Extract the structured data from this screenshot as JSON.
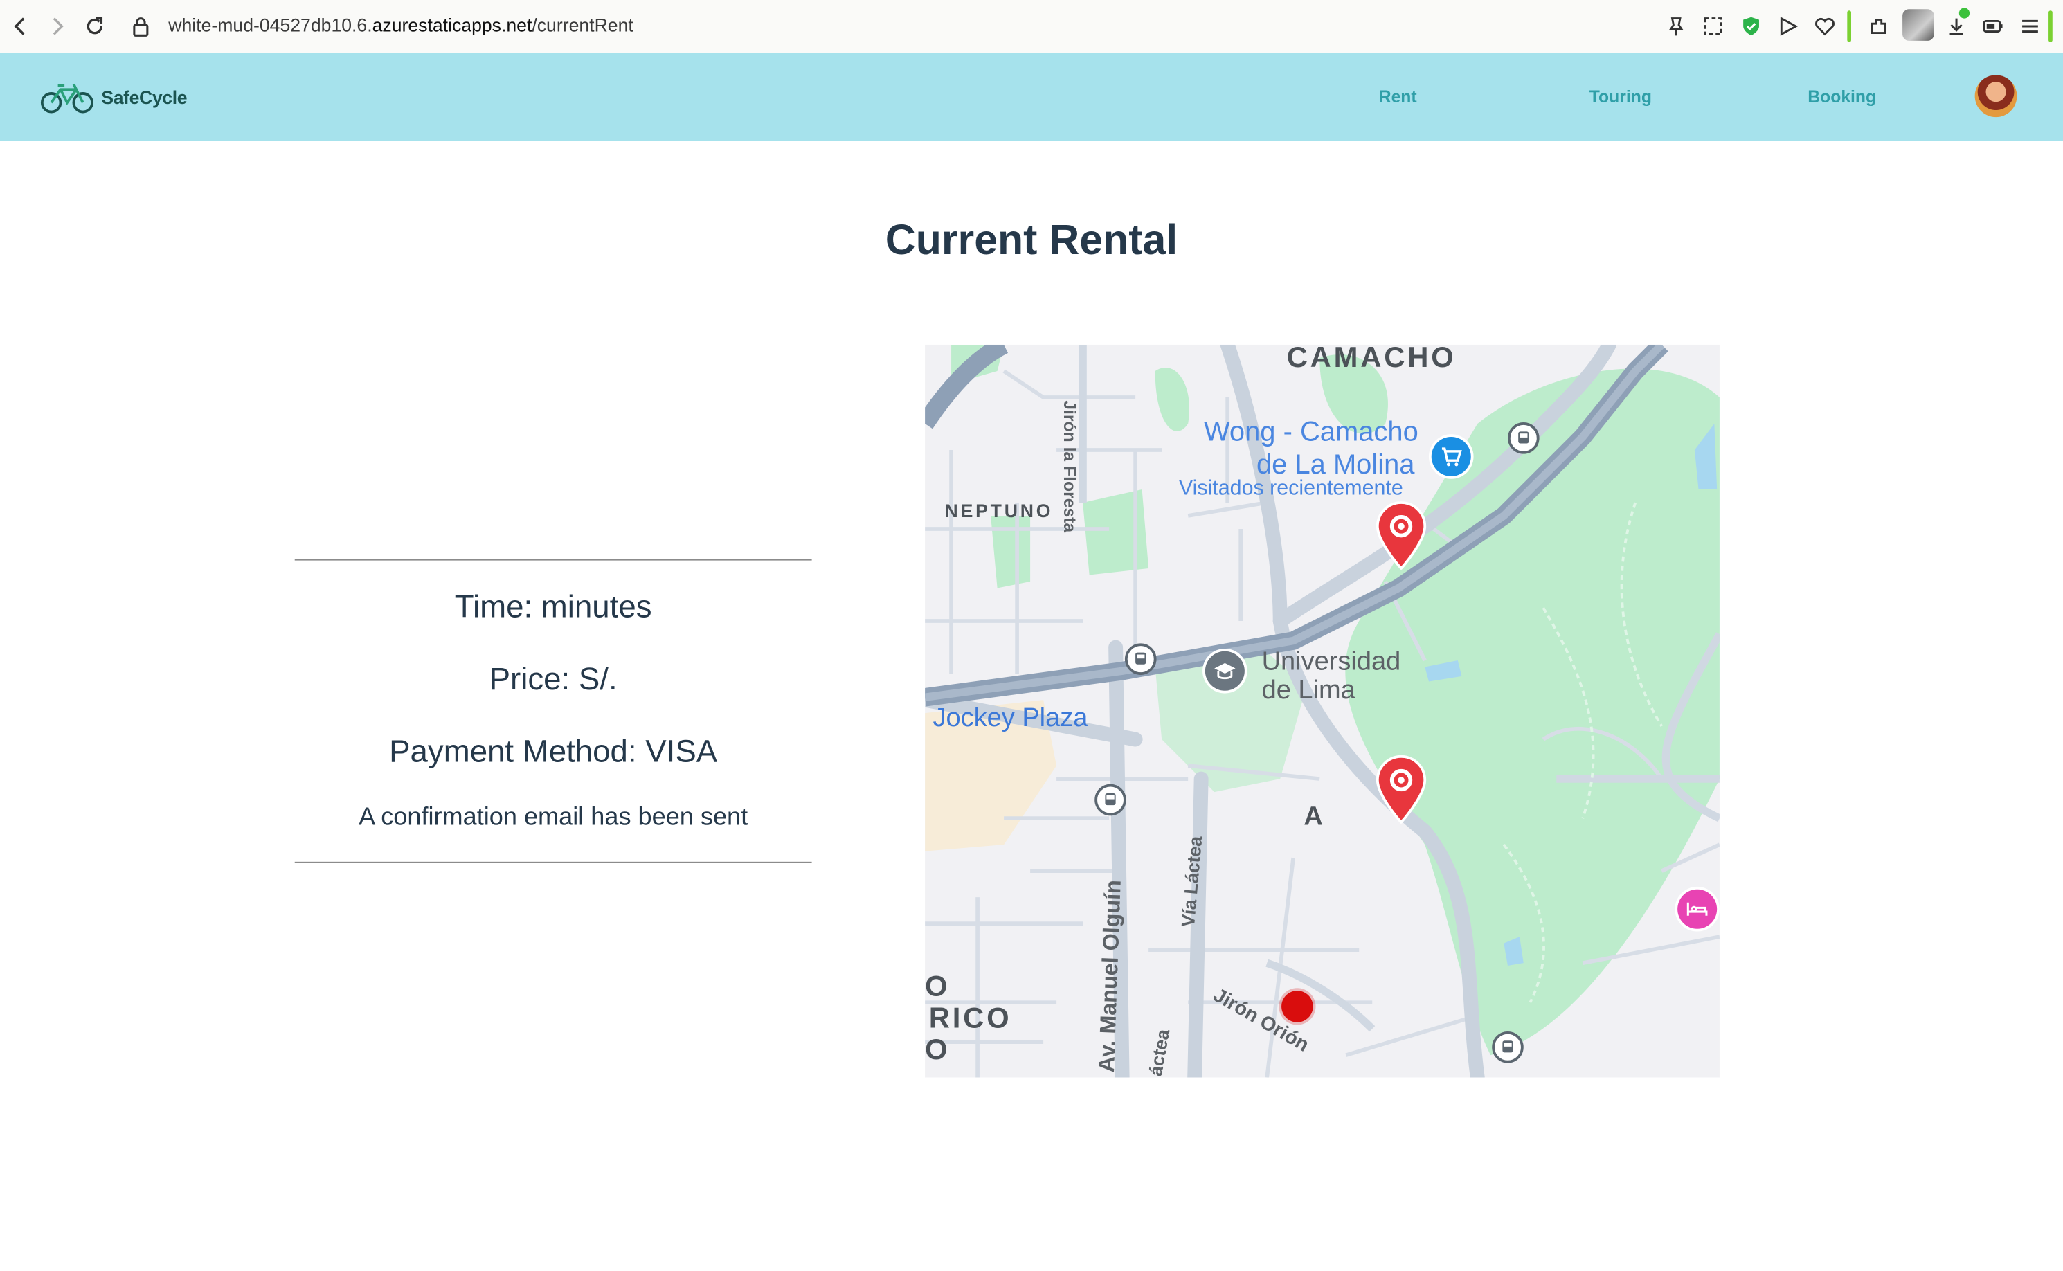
{
  "browser": {
    "url_prefix": "white-mud-04527db10.6.",
    "url_host": "azurestaticapps.net",
    "url_path": "/currentRent"
  },
  "app": {
    "logo_text": "SafeCycle",
    "nav": {
      "rent": "Rent",
      "touring": "Touring",
      "booking": "Booking"
    }
  },
  "page": {
    "title": "Current Rental",
    "time_text": "Time: minutes",
    "price_text": "Price: S/.",
    "payment_text": "Payment Method: VISA",
    "confirmation_text": "A confirmation email has been sent"
  },
  "map": {
    "labels": {
      "camacho": "CAMACHO",
      "neptuno": "NEPTUNO",
      "wong_line1": "Wong - Camacho",
      "wong_line2": "de La Molina",
      "visitados": "Visitados recientemente",
      "universidad_line1": "Universidad",
      "universidad_line2": "de Lima",
      "jockey": "Jockey Plaza",
      "area_a": "A",
      "jiron_floresta": "Jirón la Floresta",
      "via_lactea": "Vía Láctea",
      "via_lactea_2": "áctea",
      "av_manuel": "Av. Manuel Olguín",
      "jiron_orion": "Jirón Orión",
      "edge_o1": "O",
      "edge_rico": "RICO",
      "edge_o2": "O"
    },
    "colors": {
      "pin": "#e8363d",
      "park": "#bdeccc",
      "road": "#c9d2dd",
      "highway": "#8ea0b6",
      "me_dot": "#d90d0d"
    }
  }
}
